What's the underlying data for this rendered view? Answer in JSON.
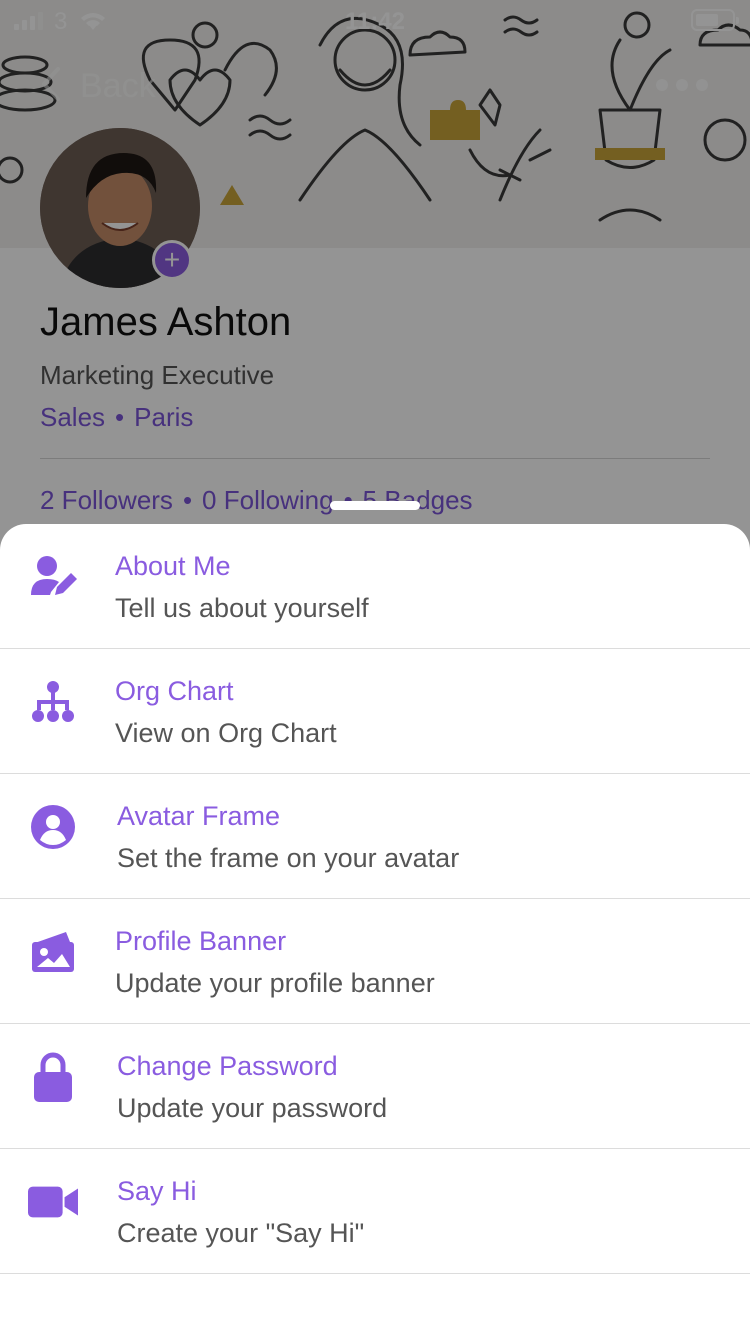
{
  "status_bar": {
    "carrier": "3",
    "time": "11:42"
  },
  "nav": {
    "back_label": "Back"
  },
  "profile": {
    "name": "James Ashton",
    "title": "Marketing Executive",
    "department": "Sales",
    "separator": "•",
    "location": "Paris",
    "stats": {
      "followers": "2 Followers",
      "following": "0 Following",
      "badges": "5 Badges"
    }
  },
  "sheet": {
    "items": [
      {
        "icon": "user-edit-icon",
        "title": "About Me",
        "subtitle": "Tell us about yourself"
      },
      {
        "icon": "org-chart-icon",
        "title": "Org Chart",
        "subtitle": "View on Org Chart"
      },
      {
        "icon": "user-circle-icon",
        "title": "Avatar Frame",
        "subtitle": "Set the frame on your avatar"
      },
      {
        "icon": "image-icon",
        "title": "Profile Banner",
        "subtitle": "Update your profile banner"
      },
      {
        "icon": "lock-icon",
        "title": "Change Password",
        "subtitle": "Update your password"
      },
      {
        "icon": "video-camera-icon",
        "title": "Say Hi",
        "subtitle": "Create your \"Say Hi\""
      }
    ]
  },
  "colors": {
    "accent": "#8a5ce0",
    "link": "#7b55d8",
    "overlay": "rgba(0,0,0,0.42)"
  }
}
